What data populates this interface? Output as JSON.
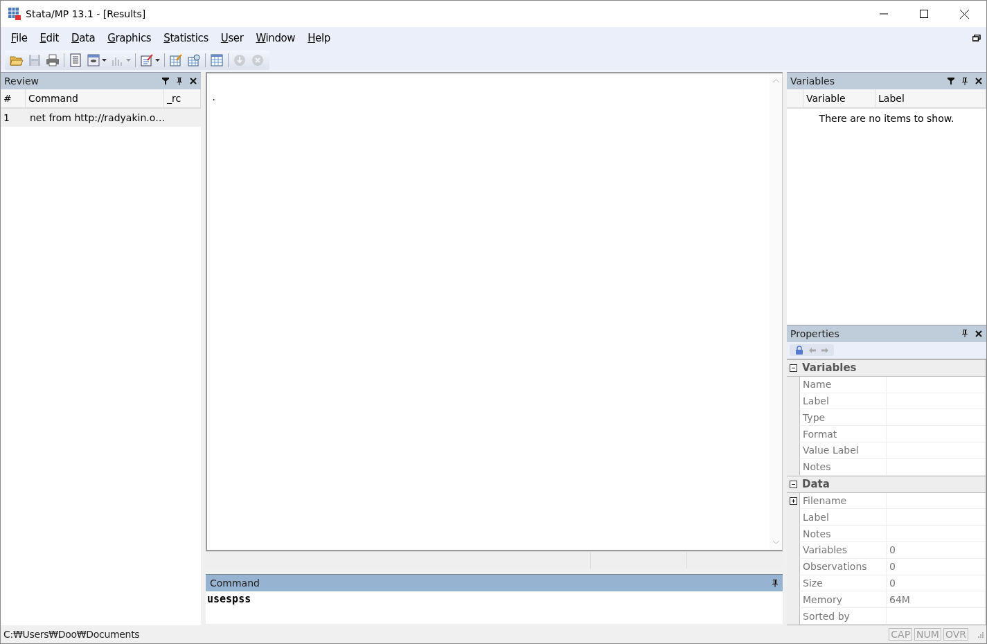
{
  "window": {
    "title": "Stata/MP 13.1 - [Results]"
  },
  "menu": [
    "File",
    "Edit",
    "Data",
    "Graphics",
    "Statistics",
    "User",
    "Window",
    "Help"
  ],
  "toolbar": [
    {
      "kind": "open",
      "disabled": false,
      "dropdown": false
    },
    {
      "kind": "save",
      "disabled": true,
      "dropdown": false
    },
    {
      "kind": "print",
      "disabled": false,
      "dropdown": false
    },
    {
      "kind": "sep"
    },
    {
      "kind": "log",
      "disabled": false,
      "dropdown": false
    },
    {
      "kind": "viewer",
      "disabled": false,
      "dropdown": true
    },
    {
      "kind": "graph",
      "disabled": true,
      "dropdown": true
    },
    {
      "kind": "sep"
    },
    {
      "kind": "dofile",
      "disabled": false,
      "dropdown": true
    },
    {
      "kind": "sep"
    },
    {
      "kind": "editor",
      "disabled": false,
      "dropdown": false
    },
    {
      "kind": "browser",
      "disabled": false,
      "dropdown": false
    },
    {
      "kind": "sep"
    },
    {
      "kind": "varmanager",
      "disabled": false,
      "dropdown": false
    },
    {
      "kind": "sep"
    },
    {
      "kind": "more",
      "disabled": true,
      "dropdown": false
    },
    {
      "kind": "break",
      "disabled": true,
      "dropdown": false
    }
  ],
  "review": {
    "title": "Review",
    "columns": [
      "#",
      "Command",
      "_rc"
    ],
    "rows": [
      {
        "num": "1",
        "command": "net from http://radyakin.o…",
        "selected": false
      }
    ]
  },
  "results": {
    "text": "."
  },
  "command": {
    "title": "Command",
    "value": "usespss"
  },
  "variables": {
    "title": "Variables",
    "columns": [
      "Variable",
      "Label"
    ],
    "empty_text": "There are no items to show."
  },
  "properties": {
    "title": "Properties",
    "sections": [
      {
        "title": "Variables",
        "expanded": true,
        "rows": [
          {
            "label": "Name"
          },
          {
            "label": "Label"
          },
          {
            "label": "Type"
          },
          {
            "label": "Format"
          },
          {
            "label": "Value Label"
          },
          {
            "label": "Notes"
          }
        ]
      },
      {
        "title": "Data",
        "expanded": true,
        "rows": [
          {
            "label": "Filename",
            "expanded": false
          },
          {
            "label": "Label"
          },
          {
            "label": "Notes"
          },
          {
            "label": "Variables",
            "value": "0"
          },
          {
            "label": "Observations",
            "value": "0"
          },
          {
            "label": "Size",
            "value": "0"
          },
          {
            "label": "Memory",
            "value": "64M"
          },
          {
            "label": "Sorted by"
          }
        ]
      }
    ]
  },
  "status_bar": {
    "path": "C:₩Users₩Doo₩Documents",
    "indicators": [
      {
        "label": "CAP",
        "on": false
      },
      {
        "label": "NUM",
        "on": false
      },
      {
        "label": "OVR",
        "on": false
      }
    ]
  }
}
